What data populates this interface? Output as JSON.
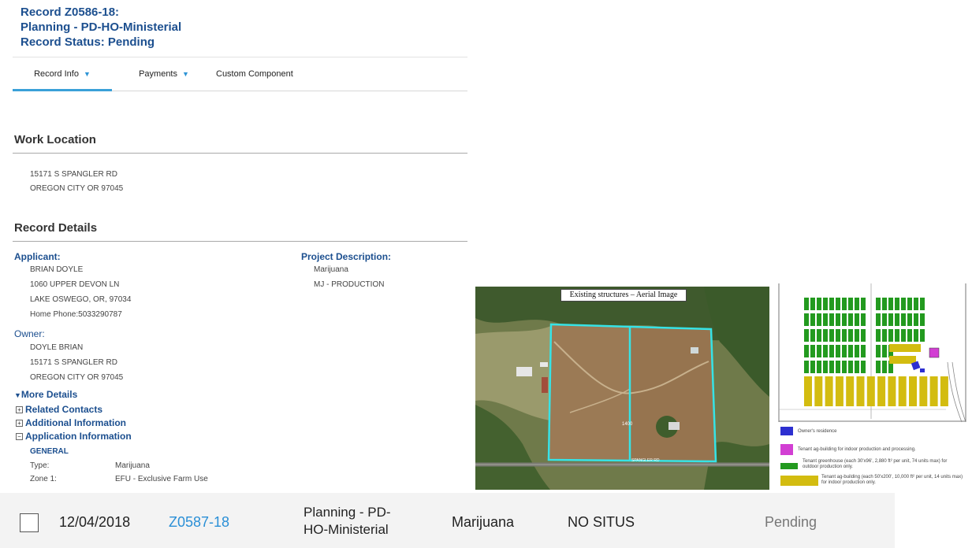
{
  "record": {
    "title_line1": "Record Z0586-18:",
    "title_line2": "Planning - PD-HO-Ministerial",
    "title_line3": "Record Status: Pending"
  },
  "tabs": [
    {
      "label": "Record Info",
      "has_dropdown": true
    },
    {
      "label": "Payments",
      "has_dropdown": true
    },
    {
      "label": "Custom Component",
      "has_dropdown": false
    }
  ],
  "work_location": {
    "heading": "Work Location",
    "line1": "15171 S SPANGLER RD",
    "line2": "OREGON CITY OR 97045"
  },
  "record_details": {
    "heading": "Record Details",
    "applicant": {
      "label": "Applicant:",
      "name": "BRIAN DOYLE",
      "street": "1060 UPPER DEVON LN",
      "city": "LAKE OSWEGO, OR, 97034",
      "phone": "Home Phone:5033290787"
    },
    "project": {
      "label": "Project Description:",
      "line1": "Marijuana",
      "line2": "MJ - PRODUCTION"
    },
    "owner": {
      "label": "Owner:",
      "name": "DOYLE BRIAN",
      "street": "15171 S SPANGLER RD",
      "city": "OREGON CITY OR 97045"
    },
    "more_details": "More Details",
    "related_contacts": "Related Contacts",
    "additional_info": "Additional Information",
    "application_info": "Application Information",
    "general": "GENERAL",
    "type_label": "Type:",
    "type_value": "Marijuana",
    "zone_label": "Zone 1:",
    "zone_value": "EFU - Exclusive Farm Use"
  },
  "aerial": {
    "label": "Existing structures – Aerial Image",
    "field_marker": "1400",
    "road_marker": "SPANGLER RD"
  },
  "site_plan": {
    "legend": [
      {
        "color": "#2d2fd0",
        "text": "Owner's residence"
      },
      {
        "color": "#d23fd3",
        "text": "Tenant ag-building for indoor production and processing."
      },
      {
        "color": "#239a1f",
        "text": "Tenant greenhouse (each 30'x96', 2,880 ft² per unit, 74 units max) for outdoor production only."
      },
      {
        "color": "#d3bc10",
        "text": "Tenant ag-building (each 50'x200', 10,000 ft² per unit, 14 units max) for indoor production only."
      }
    ]
  },
  "result_row": {
    "date": "12/04/2018",
    "record_id": "Z0587-18",
    "type_line1": "Planning - PD-",
    "type_line2": "HO-Ministerial",
    "description": "Marijuana",
    "address": "NO SITUS",
    "status": "Pending"
  }
}
